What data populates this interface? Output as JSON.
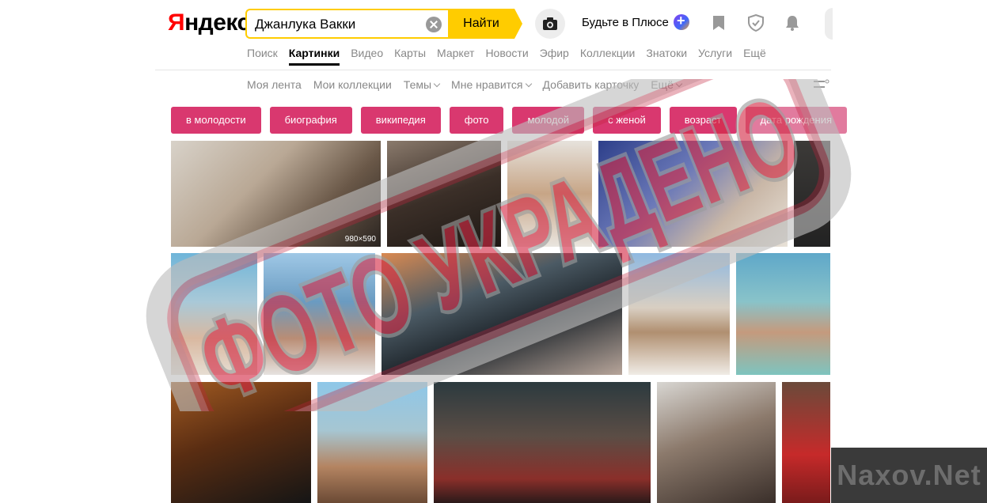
{
  "header": {
    "logo_first": "Я",
    "logo_rest": "ндекс",
    "search_value": "Джанлука Вакки",
    "search_button": "Найти",
    "plus_text": "Будьте в Плюсе"
  },
  "services": [
    {
      "label": "Поиск",
      "active": false
    },
    {
      "label": "Картинки",
      "active": true
    },
    {
      "label": "Видео",
      "active": false
    },
    {
      "label": "Карты",
      "active": false
    },
    {
      "label": "Маркет",
      "active": false
    },
    {
      "label": "Новости",
      "active": false
    },
    {
      "label": "Эфир",
      "active": false
    },
    {
      "label": "Коллекции",
      "active": false
    },
    {
      "label": "Знатоки",
      "active": false
    },
    {
      "label": "Услуги",
      "active": false
    },
    {
      "label": "Ещё",
      "active": false
    }
  ],
  "subnav": {
    "feed": "Моя лента",
    "collections": "Мои коллекции",
    "themes": "Темы",
    "likes": "Мне нравится",
    "add_card": "Добавить карточку",
    "more": "Ещё"
  },
  "chips": [
    "в молодости",
    "биография",
    "википедия",
    "фото",
    "молодой",
    "с женой",
    "возраст",
    "дата рождения"
  ],
  "images": {
    "first_dims": "980×590"
  },
  "watermark": {
    "stamp_text": "ФОТО УКРАДЕНО",
    "corner_text": "Naxov.Net"
  },
  "colors": {
    "accent_yellow": "#ffcc00",
    "chip_pink": "#d9386f",
    "logo_red": "#ff0000"
  }
}
